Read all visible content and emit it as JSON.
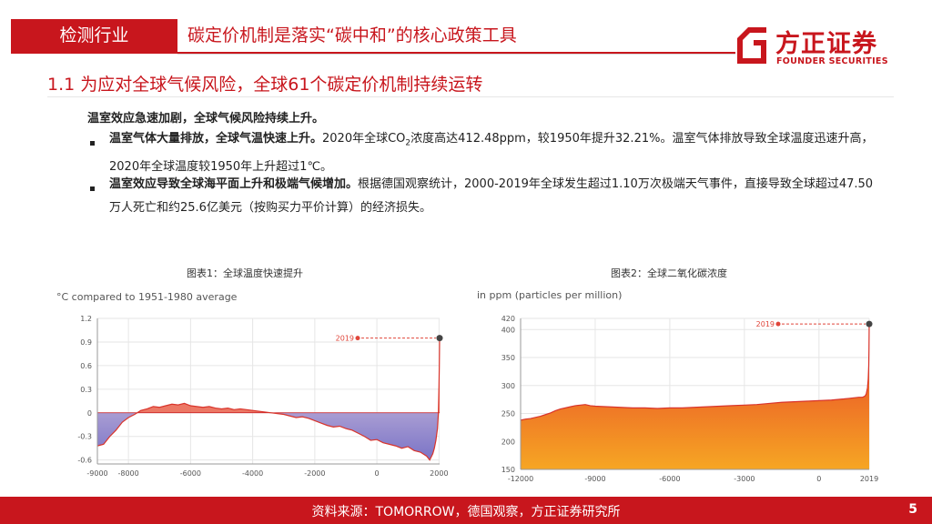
{
  "header": {
    "tab_label": "检测行业",
    "title": "碳定价机制是落实“碳中和”的核心政策工具"
  },
  "logo": {
    "cn": "方正证券",
    "en": "FOUNDER SECURITIES"
  },
  "section_title": "1.1 为应对全球气候风险，全球61个碳定价机制持续运转",
  "lead": "温室效应急速加剧，全球气候风险持续上升。",
  "bullets": [
    {
      "bold": "温室气体大量排放，全球气温快速上升。",
      "pre": "2020年全球CO",
      "sub": "2",
      "post": "浓度高达412.48ppm，较1950年提升32.21%。温室气体排放导致全球温度迅速升高，2020年全球温度较1950年上升超过1℃。"
    },
    {
      "bold": "温室效应导致全球海平面上升和极端气候增加。",
      "text": "根据德国观察统计，2000-2019年全球发生超过1.10万次极端天气事件，直接导致全球超过47.50万人死亡和约25.6亿美元（按购买力平价计算）的经济损失。"
    }
  ],
  "chart_data": [
    {
      "type": "area",
      "caption": "图表1：全球温度快速提升",
      "ylabel": "°C compared to 1951-1980 average",
      "xlim": [
        -9000,
        2019
      ],
      "ylim": [
        -0.65,
        1.2
      ],
      "yticks": [
        1.2,
        0.9,
        0.6,
        0.3,
        0,
        -0.3,
        -0.6
      ],
      "ytick_labels": [
        "1.2",
        "0.9",
        "0.6",
        "0.3",
        "0",
        "-0.3",
        "-0.6"
      ],
      "xticks": [
        -9000,
        -8000,
        -6000,
        -4000,
        -2000,
        0,
        2000
      ],
      "xtick_labels": [
        "-9000",
        "-8000",
        "-6000",
        "-4000",
        "-2000",
        "0",
        "2000"
      ],
      "colors": {
        "positive": "#e9604a",
        "negative": "#7a73c6",
        "line": "#d9342b"
      },
      "annotation": {
        "label": "2019",
        "x": 2019,
        "y": 0.95
      },
      "x": [
        -9000,
        -8800,
        -8600,
        -8400,
        -8200,
        -8000,
        -7800,
        -7600,
        -7400,
        -7200,
        -7000,
        -6800,
        -6600,
        -6400,
        -6200,
        -6000,
        -5800,
        -5600,
        -5400,
        -5200,
        -5000,
        -4800,
        -4600,
        -4400,
        -4200,
        -4000,
        -3800,
        -3600,
        -3400,
        -3200,
        -3000,
        -2800,
        -2600,
        -2400,
        -2200,
        -2000,
        -1800,
        -1600,
        -1400,
        -1200,
        -1000,
        -800,
        -600,
        -400,
        -200,
        0,
        200,
        400,
        600,
        800,
        1000,
        1200,
        1400,
        1600,
        1700,
        1800,
        1850,
        1900,
        1950,
        1980,
        2000,
        2010,
        2019
      ],
      "y": [
        -0.42,
        -0.4,
        -0.3,
        -0.22,
        -0.12,
        -0.06,
        -0.02,
        0.03,
        0.05,
        0.08,
        0.07,
        0.09,
        0.11,
        0.1,
        0.12,
        0.09,
        0.08,
        0.07,
        0.08,
        0.06,
        0.05,
        0.06,
        0.04,
        0.05,
        0.04,
        0.03,
        0.02,
        0.01,
        0.0,
        -0.01,
        -0.02,
        -0.04,
        -0.06,
        -0.05,
        -0.07,
        -0.1,
        -0.13,
        -0.16,
        -0.18,
        -0.17,
        -0.2,
        -0.22,
        -0.26,
        -0.3,
        -0.35,
        -0.34,
        -0.38,
        -0.4,
        -0.42,
        -0.45,
        -0.43,
        -0.48,
        -0.5,
        -0.55,
        -0.6,
        -0.52,
        -0.45,
        -0.35,
        -0.2,
        0.0,
        0.35,
        0.6,
        0.95
      ]
    },
    {
      "type": "area",
      "caption": "图表2：全球二氧化碳浓度",
      "ylabel": "in ppm (particles per million)",
      "xlim": [
        -12000,
        2019
      ],
      "ylim": [
        150,
        420
      ],
      "yticks": [
        420,
        400,
        350,
        300,
        250,
        200,
        150
      ],
      "ytick_labels": [
        "420",
        "400",
        "350",
        "300",
        "250",
        "200",
        "150"
      ],
      "xticks": [
        -12000,
        -9000,
        -6000,
        -3000,
        0,
        2019
      ],
      "xtick_labels": [
        "-12000",
        "-9000",
        "-6000",
        "-3000",
        "0",
        "2019"
      ],
      "colors": {
        "top": "#e63a2a",
        "bottom": "#f6a623",
        "line": "#d9342b"
      },
      "annotation": {
        "label": "2019",
        "x": 2019,
        "y": 410
      },
      "x": [
        -12000,
        -11800,
        -11600,
        -11400,
        -11200,
        -11000,
        -10800,
        -10600,
        -10400,
        -10200,
        -10000,
        -9800,
        -9600,
        -9400,
        -9200,
        -9000,
        -8500,
        -8000,
        -7500,
        -7000,
        -6500,
        -6000,
        -5500,
        -5000,
        -4500,
        -4000,
        -3500,
        -3000,
        -2500,
        -2000,
        -1500,
        -1000,
        -500,
        0,
        500,
        1000,
        1200,
        1400,
        1600,
        1750,
        1800,
        1850,
        1900,
        1950,
        1980,
        2000,
        2010,
        2019
      ],
      "y": [
        238,
        240,
        241,
        243,
        245,
        248,
        251,
        255,
        258,
        260,
        262,
        264,
        265,
        266,
        264,
        263,
        262,
        261,
        260,
        260,
        259,
        260,
        260,
        261,
        262,
        263,
        264,
        265,
        266,
        268,
        270,
        271,
        272,
        273,
        274,
        276,
        277,
        278,
        279,
        279,
        280,
        281,
        285,
        296,
        312,
        335,
        365,
        410
      ]
    }
  ],
  "footer": {
    "source": "资料来源：TOMORROW，德国观察，方正证券研究所",
    "page": "5"
  }
}
